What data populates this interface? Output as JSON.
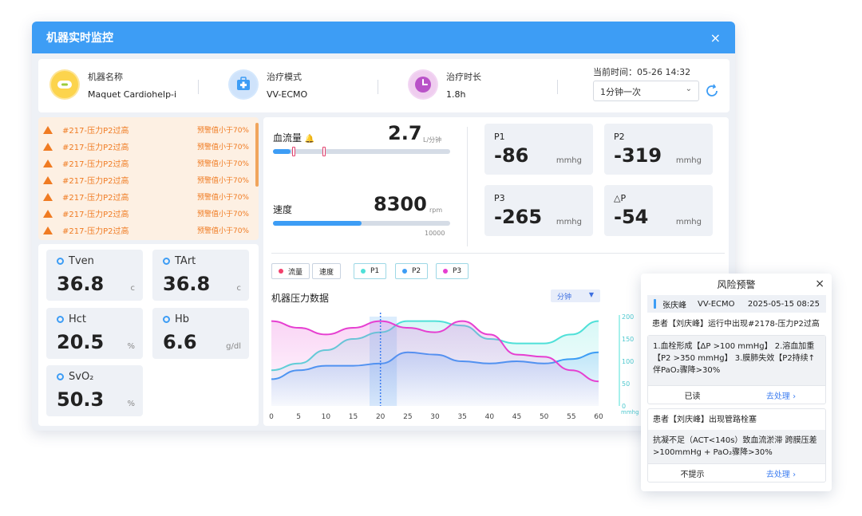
{
  "window": {
    "title": "机器实时监控",
    "close": "×"
  },
  "info": {
    "machine_label": "机器名称",
    "machine_value": "Maquet Cardiohelp-i",
    "mode_label": "治疗模式",
    "mode_value": "VV-ECMO",
    "duration_label": "治疗时长",
    "duration_value": "1.8h",
    "current_time": "当前时间：05-26   14:32",
    "interval_select": "1分钟一次"
  },
  "alerts": [
    {
      "text": "#217-压力P2过高",
      "threshold": "预警值小于70%"
    },
    {
      "text": "#217-压力P2过高",
      "threshold": "预警值小于70%"
    },
    {
      "text": "#217-压力P2过高",
      "threshold": "预警值小于70%"
    },
    {
      "text": "#217-压力P2过高",
      "threshold": "预警值小于70%"
    },
    {
      "text": "#217-压力P2过高",
      "threshold": "预警值小于70%"
    },
    {
      "text": "#217-压力P2过高",
      "threshold": "预警值小于70%"
    },
    {
      "text": "#217-压力P2过高",
      "threshold": "预警值小于70%"
    }
  ],
  "vitals": {
    "tven": {
      "label": "Tven",
      "value": "36.8",
      "unit": "c"
    },
    "tart": {
      "label": "TArt",
      "value": "36.8",
      "unit": "c"
    },
    "hct": {
      "label": "Hct",
      "value": "20.5",
      "unit": "%"
    },
    "hb": {
      "label": "Hb",
      "value": "6.6",
      "unit": "g/dl"
    },
    "svo2": {
      "label": "SvO₂",
      "value": "50.3",
      "unit": "%"
    }
  },
  "flow": {
    "label": "血流量",
    "value": "2.7",
    "unit": "L/分钟",
    "level": 0.1
  },
  "speed": {
    "label": "速度",
    "value": "8300",
    "unit": "rpm",
    "max": "10000",
    "level": 0.5
  },
  "pressures": {
    "p1": {
      "label": "P1",
      "value": "-86",
      "unit": "mmhg"
    },
    "p2": {
      "label": "P2",
      "value": "-319",
      "unit": "mmhg"
    },
    "p3": {
      "label": "P3",
      "value": "-265",
      "unit": "mmhg"
    },
    "dp": {
      "label": "△P",
      "value": "-54",
      "unit": "mmhg"
    }
  },
  "legend": [
    {
      "label": "流量",
      "color": "#f2416c"
    },
    {
      "label": "速度",
      "color": ""
    },
    {
      "label": "P1",
      "color": "#4fe0d8"
    },
    {
      "label": "P2",
      "color": "#3d9df5"
    },
    {
      "label": "P3",
      "color": "#e63fd1"
    }
  ],
  "chart_header": {
    "title": "机器压力数据",
    "unit_select": "分钟"
  },
  "chart_data": {
    "type": "line",
    "x": [
      0,
      5,
      10,
      15,
      20,
      25,
      30,
      35,
      40,
      45,
      50,
      55,
      60
    ],
    "x_ticks": [
      "0",
      "5",
      "10",
      "15",
      "20",
      "25",
      "30",
      "35",
      "40",
      "45",
      "50",
      "55",
      "60"
    ],
    "y_ticks": [
      "0",
      "50",
      "100",
      "150",
      "200"
    ],
    "y_unit": "mmhg",
    "ylim": [
      0,
      200
    ],
    "series": [
      {
        "color": "#4fe0d8",
        "values": [
          80,
          95,
          125,
          150,
          165,
          190,
          190,
          180,
          150,
          140,
          140,
          160,
          190
        ]
      },
      {
        "color": "#3d9df5",
        "values": [
          60,
          80,
          90,
          90,
          95,
          120,
          115,
          100,
          95,
          100,
          95,
          105,
          120
        ]
      },
      {
        "color": "#e63fd1",
        "values": [
          190,
          175,
          160,
          175,
          190,
          175,
          165,
          190,
          160,
          115,
          110,
          80,
          55
        ]
      }
    ],
    "highlight_x": [
      18,
      23
    ],
    "cursor_x": 20
  },
  "popup": {
    "title": "风险预警",
    "close": "×",
    "user": "张庆峰",
    "mode": "VV-ECMO",
    "datetime": "2025-05-15 08:25",
    "msg1": "患者【刘庆峰】运行中出现#2178-压力P2过高",
    "detail1": "1.血栓形成【ΔP >100 mmHg】  2.溶血加重【P2 >350 mmHg】  3.膜肺失效【P2持续↑伴PaO₂骤降>30%",
    "read": "已读",
    "handle1": "去处理 ›",
    "msg2": "患者【刘庆峰】出现管路栓塞",
    "detail2": "抗凝不足（ACT<140s）致血流淤滞  跨膜压差>100mmHg + PaO₂骤降>30%",
    "ignore": "不提示",
    "handle2": "去处理 ›"
  }
}
